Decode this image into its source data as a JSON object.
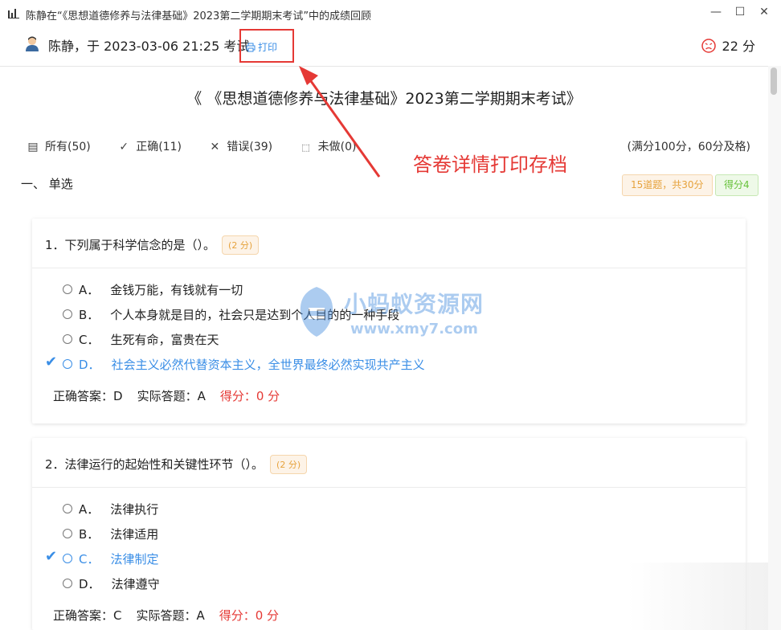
{
  "window": {
    "title": "陈静在“《思想道德修养与法律基础》2023第二学期期末考试”中的成绩回顾",
    "buttons": {
      "minimize": "—",
      "maximize": "☐",
      "close": "✕"
    }
  },
  "header": {
    "user_line": "陈静，于 2023-03-06 21:25 考试",
    "print_label": "打印",
    "score": "22 分"
  },
  "exam_title": "《 《思想道德修养与法律基础》2023第二学期期末考试》",
  "filters": [
    {
      "icon": "list-icon",
      "label": "所有(50)"
    },
    {
      "icon": "check-icon",
      "label": "正确(11)"
    },
    {
      "icon": "cross-icon",
      "label": "错误(39)"
    },
    {
      "icon": "square-icon",
      "label": "未做(0)"
    }
  ],
  "pass_note": "(满分100分，60分及格)",
  "annotation": "答卷详情打印存档",
  "section": {
    "title": "一、  单选",
    "count_badge": "15道题，共30分",
    "score_badge": "得分4"
  },
  "watermark": {
    "cn": "小蚂蚁资源网",
    "en": "www.xmy7.com"
  },
  "questions": [
    {
      "text": "1．下列属于科学信念的是（）。",
      "points": "(2 分)",
      "options": [
        {
          "letter": "A．",
          "text": "金钱万能，有钱就有一切",
          "correct": false
        },
        {
          "letter": "B．",
          "text": "个人本身就是目的，社会只是达到个人目的的一种手段",
          "correct": false
        },
        {
          "letter": "C．",
          "text": "生死有命，富贵在天",
          "correct": false
        },
        {
          "letter": "D．",
          "text": "社会主义必然代替资本主义，全世界最终必然实现共产主义",
          "correct": true
        }
      ],
      "correct_answer": "正确答案：D",
      "actual_answer": "实际答题：A",
      "score": "得分：0 分"
    },
    {
      "text": "2．法律运行的起始性和关键性环节（）。",
      "points": "(2 分)",
      "options": [
        {
          "letter": "A．",
          "text": "法律执行",
          "correct": false
        },
        {
          "letter": "B．",
          "text": "法律适用",
          "correct": false
        },
        {
          "letter": "C．",
          "text": "法律制定",
          "correct": true
        },
        {
          "letter": "D．",
          "text": "法律遵守",
          "correct": false
        }
      ],
      "correct_answer": "正确答案：C",
      "actual_answer": "实际答题：A",
      "score": "得分：0 分"
    }
  ]
}
